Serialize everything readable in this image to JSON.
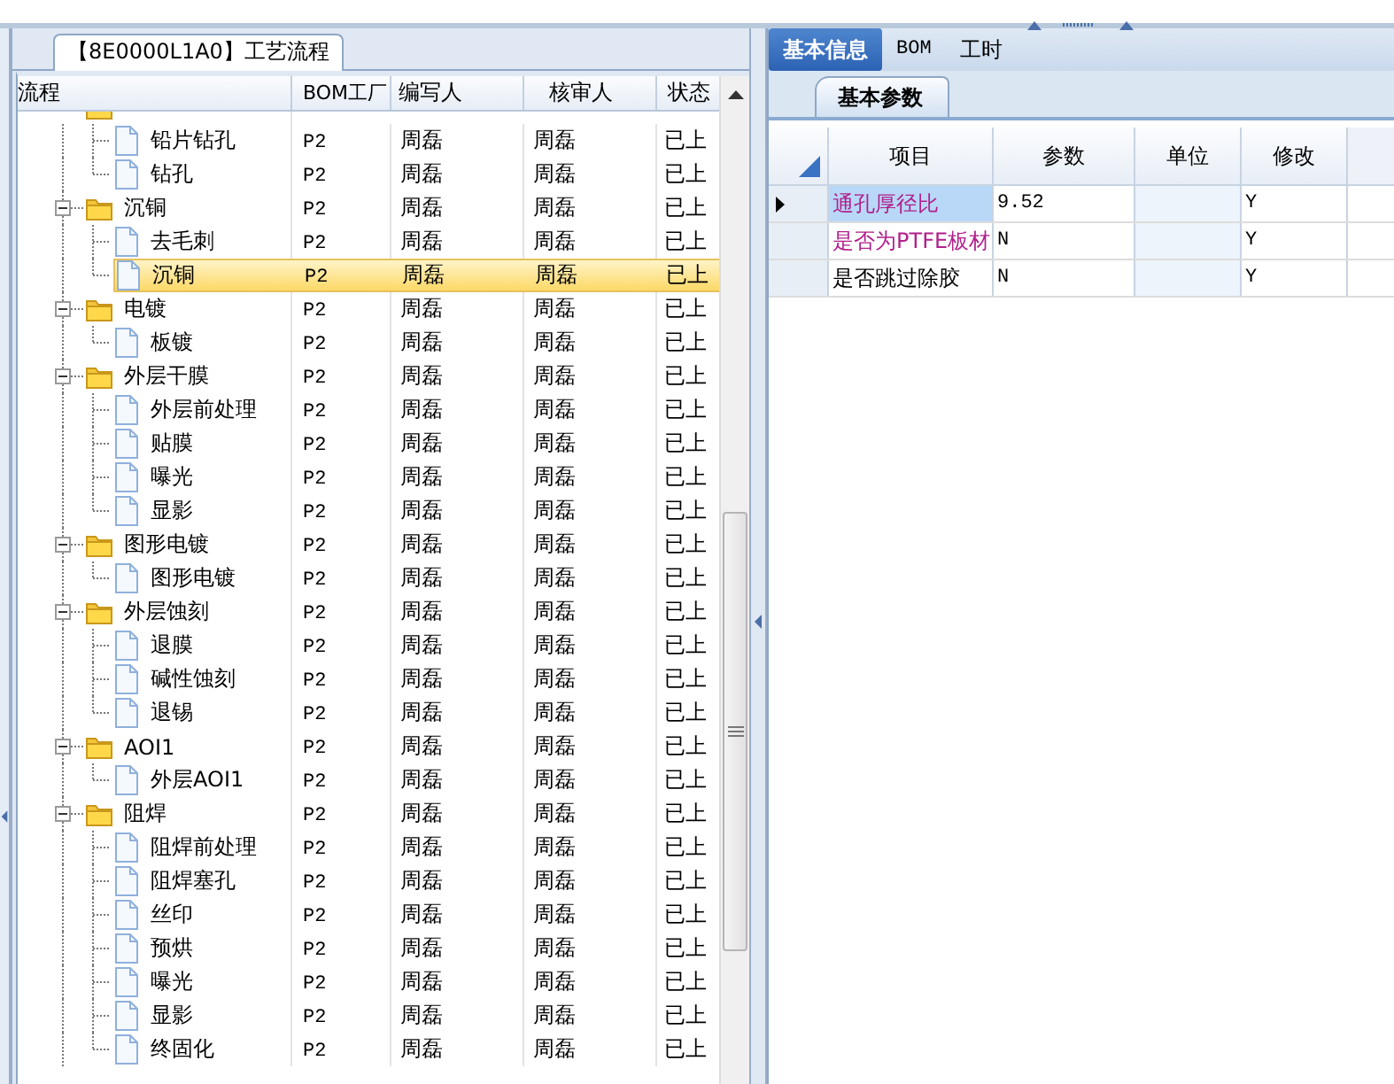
{
  "process_panel": {
    "tab": "【8E0000L1A0】工艺流程",
    "columns": [
      "流程",
      "BOM工厂",
      "编写人",
      "核审人",
      "状态"
    ],
    "nodes": [
      {
        "kind": "folder",
        "selected": false,
        "children": [
          {
            "kind": "leaf",
            "label": "铅片钻孔",
            "cells": [
              "P2",
              "周磊",
              "周磊",
              "已上"
            ],
            "selected": false
          },
          {
            "kind": "leaf",
            "label": "钻孔",
            "cells": [
              "P2",
              "周磊",
              "周磊",
              "已上"
            ],
            "selected": false
          }
        ]
      },
      {
        "kind": "folder",
        "label": "沉铜",
        "cells": [
          "P2",
          "周磊",
          "周磊",
          "已上"
        ],
        "expanded": true,
        "selected": false,
        "children": [
          {
            "kind": "leaf",
            "label": "去毛刺",
            "cells": [
              "P2",
              "周磊",
              "周磊",
              "已上"
            ],
            "selected": false
          },
          {
            "kind": "leaf",
            "label": "沉铜",
            "cells": [
              "P2",
              "周磊",
              "周磊",
              "已上"
            ],
            "selected": true
          }
        ]
      },
      {
        "kind": "folder",
        "label": "电镀",
        "cells": [
          "P2",
          "周磊",
          "周磊",
          "已上"
        ],
        "expanded": true,
        "selected": false,
        "children": [
          {
            "kind": "leaf",
            "label": "板镀",
            "cells": [
              "P2",
              "周磊",
              "周磊",
              "已上"
            ],
            "selected": false
          }
        ]
      },
      {
        "kind": "folder",
        "label": "外层干膜",
        "cells": [
          "P2",
          "周磊",
          "周磊",
          "已上"
        ],
        "expanded": true,
        "selected": false,
        "children": [
          {
            "kind": "leaf",
            "label": "外层前处理",
            "cells": [
              "P2",
              "周磊",
              "周磊",
              "已上"
            ],
            "selected": false
          },
          {
            "kind": "leaf",
            "label": "贴膜",
            "cells": [
              "P2",
              "周磊",
              "周磊",
              "已上"
            ],
            "selected": false
          },
          {
            "kind": "leaf",
            "label": "曝光",
            "cells": [
              "P2",
              "周磊",
              "周磊",
              "已上"
            ],
            "selected": false
          },
          {
            "kind": "leaf",
            "label": "显影",
            "cells": [
              "P2",
              "周磊",
              "周磊",
              "已上"
            ],
            "selected": false
          }
        ]
      },
      {
        "kind": "folder",
        "label": "图形电镀",
        "cells": [
          "P2",
          "周磊",
          "周磊",
          "已上"
        ],
        "expanded": true,
        "selected": false,
        "children": [
          {
            "kind": "leaf",
            "label": "图形电镀",
            "cells": [
              "P2",
              "周磊",
              "周磊",
              "已上"
            ],
            "selected": false
          }
        ]
      },
      {
        "kind": "folder",
        "label": "外层蚀刻",
        "cells": [
          "P2",
          "周磊",
          "周磊",
          "已上"
        ],
        "expanded": true,
        "selected": false,
        "children": [
          {
            "kind": "leaf",
            "label": "退膜",
            "cells": [
              "P2",
              "周磊",
              "周磊",
              "已上"
            ],
            "selected": false
          },
          {
            "kind": "leaf",
            "label": "碱性蚀刻",
            "cells": [
              "P2",
              "周磊",
              "周磊",
              "已上"
            ],
            "selected": false
          },
          {
            "kind": "leaf",
            "label": "退锡",
            "cells": [
              "P2",
              "周磊",
              "周磊",
              "已上"
            ],
            "selected": false
          }
        ]
      },
      {
        "kind": "folder",
        "label": "AOI1",
        "cells": [
          "P2",
          "周磊",
          "周磊",
          "已上"
        ],
        "expanded": true,
        "selected": false,
        "children": [
          {
            "kind": "leaf",
            "label": "外层AOI1",
            "cells": [
              "P2",
              "周磊",
              "周磊",
              "已上"
            ],
            "selected": false
          }
        ]
      },
      {
        "kind": "folder",
        "label": "阻焊",
        "cells": [
          "P2",
          "周磊",
          "周磊",
          "已上"
        ],
        "expanded": true,
        "selected": false,
        "children": [
          {
            "kind": "leaf",
            "label": "阻焊前处理",
            "cells": [
              "P2",
              "周磊",
              "周磊",
              "已上"
            ],
            "selected": false
          },
          {
            "kind": "leaf",
            "label": "阻焊塞孔",
            "cells": [
              "P2",
              "周磊",
              "周磊",
              "已上"
            ],
            "selected": false
          },
          {
            "kind": "leaf",
            "label": "丝印",
            "cells": [
              "P2",
              "周磊",
              "周磊",
              "已上"
            ],
            "selected": false
          },
          {
            "kind": "leaf",
            "label": "预烘",
            "cells": [
              "P2",
              "周磊",
              "周磊",
              "已上"
            ],
            "selected": false
          },
          {
            "kind": "leaf",
            "label": "曝光",
            "cells": [
              "P2",
              "周磊",
              "周磊",
              "已上"
            ],
            "selected": false
          },
          {
            "kind": "leaf",
            "label": "显影",
            "cells": [
              "P2",
              "周磊",
              "周磊",
              "已上"
            ],
            "selected": false
          },
          {
            "kind": "leaf",
            "label": "终固化",
            "cells": [
              "P2",
              "周磊",
              "周磊",
              "已上"
            ],
            "selected": false
          }
        ]
      }
    ]
  },
  "info_panel": {
    "tabs": [
      {
        "label": "基本信息",
        "selected": true
      },
      {
        "label": "BOM",
        "selected": false
      },
      {
        "label": "工时",
        "selected": false
      }
    ],
    "subtabs": [
      {
        "label": "基本参数",
        "selected": true
      }
    ],
    "columns": [
      "项目",
      "参数",
      "单位",
      "修改"
    ],
    "rows": [
      {
        "item": "通孔厚径比",
        "color": "#b0208c",
        "value": "9.52",
        "modify": "Y",
        "current": true,
        "selected": true
      },
      {
        "item": "是否为PTFE板材",
        "color": "#b0208c",
        "value": "N",
        "modify": "Y",
        "selected": false
      },
      {
        "item": "是否跳过除胶",
        "color": "#000000",
        "value": "N",
        "modify": "Y",
        "selected": false
      }
    ]
  }
}
